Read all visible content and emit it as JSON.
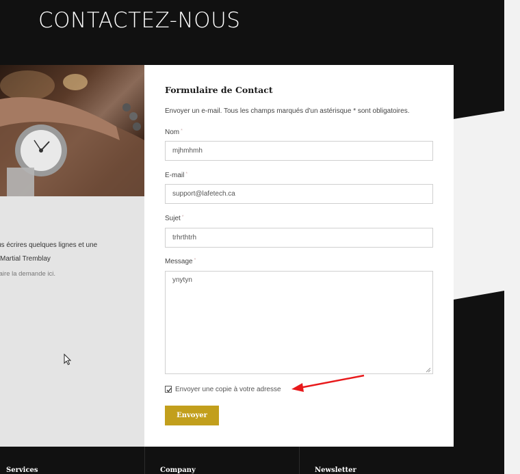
{
  "header": {
    "title": "CONTACTEZ-NOUS"
  },
  "sidebar": {
    "text_line1": "us écrires quelques lignes et une",
    "text_line2": "Martial Tremblay",
    "note": "faire la demande ici."
  },
  "form": {
    "heading": "Formulaire de Contact",
    "description": "Envoyer un e-mail. Tous les champs marqués d'un astérisque * sont obligatoires.",
    "required_mark": "*",
    "name": {
      "label": "Nom",
      "value": "mjhmhmh"
    },
    "email": {
      "label": "E-mail",
      "value": "support@lafetech.ca"
    },
    "subject": {
      "label": "Sujet",
      "value": "trhrthtrh"
    },
    "message": {
      "label": "Message",
      "value": "ynytyn"
    },
    "copy_label": "Envoyer une copie à votre adresse",
    "copy_checked": true,
    "submit_label": "Envoyer"
  },
  "footer": {
    "columns": [
      "Services",
      "Company",
      "Newsletter"
    ]
  },
  "colors": {
    "accent": "#c29f1c",
    "annotation": "#e8191b",
    "dark_bg": "#111111"
  }
}
